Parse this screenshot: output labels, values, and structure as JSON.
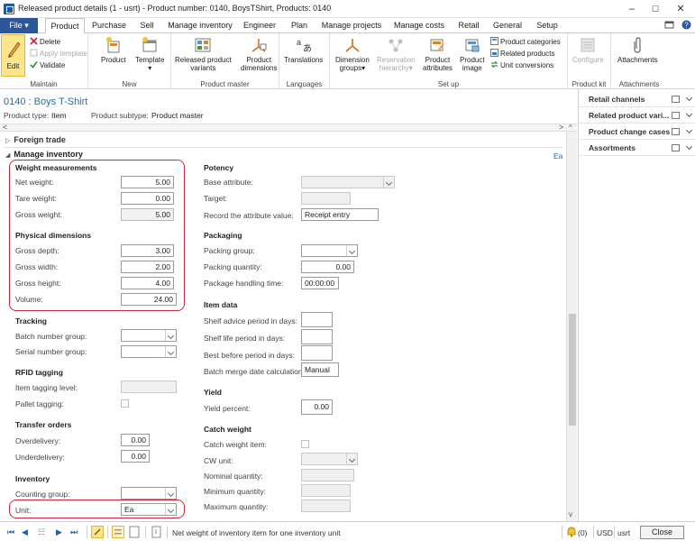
{
  "window": {
    "title": "Released product details (1 - usrt) - Product number: 0140, BoysTShirt, Products: 0140",
    "controls": {
      "minimize": "–",
      "maximize": "☐",
      "close": "✕"
    }
  },
  "ribbon_tabs": {
    "file": "File",
    "file_caret": "▾",
    "items": [
      "Product",
      "Purchase",
      "Sell",
      "Manage inventory",
      "Engineer",
      "Plan",
      "Manage projects",
      "Manage costs",
      "Retail",
      "General",
      "Setup"
    ],
    "active_index": 0
  },
  "ribbon": {
    "maintain": {
      "label": "Maintain",
      "edit": "Edit",
      "delete": "Delete",
      "apply_template": "Apply template",
      "validate": "Validate"
    },
    "new": {
      "label": "New",
      "product": "Product",
      "template": "Template"
    },
    "product_master": {
      "label": "Product master",
      "released_product_variants_1": "Released product",
      "released_product_variants_2": "variants",
      "product_dimensions_1": "Product",
      "product_dimensions_2": "dimensions"
    },
    "languages": {
      "label": "Languages",
      "translations": "Translations"
    },
    "setup": {
      "label": "Set up",
      "dimension_groups_1": "Dimension",
      "dimension_groups_2": "groups▾",
      "reservation_hierarchy_1": "Reservation",
      "reservation_hierarchy_2": "hierarchy▾",
      "product_attributes_1": "Product",
      "product_attributes_2": "attributes",
      "product_image_1": "Product",
      "product_image_2": "image",
      "product_categories": "Product categories",
      "related_products": "Related products",
      "unit_conversions": "Unit conversions"
    },
    "product_kit": {
      "label": "Product kit",
      "configure": "Configure"
    },
    "attachments": {
      "label": "Attachments",
      "attachments": "Attachments"
    }
  },
  "header": {
    "record_title": "0140 : Boys T-Shirt",
    "product_type_label": "Product type:",
    "product_type_value": "Item",
    "product_subtype_label": "Product subtype:",
    "product_subtype_value": "Product master"
  },
  "fasttabs": {
    "foreign_trade": "Foreign trade",
    "manage_inventory": "Manage inventory",
    "unit_hint": "Ea"
  },
  "weight_measurements": {
    "title": "Weight measurements",
    "net_weight_label": "Net weight:",
    "net_weight_value": "5.00",
    "tare_weight_label": "Tare weight:",
    "tare_weight_value": "0.00",
    "gross_weight_label": "Gross weight:",
    "gross_weight_value": "5.00"
  },
  "physical_dimensions": {
    "title": "Physical dimensions",
    "gross_depth_label": "Gross depth:",
    "gross_depth_value": "3.00",
    "gross_width_label": "Gross width:",
    "gross_width_value": "2.00",
    "gross_height_label": "Gross height:",
    "gross_height_value": "4.00",
    "volume_label": "Volume:",
    "volume_value": "24.00"
  },
  "tracking": {
    "title": "Tracking",
    "batch_number_group_label": "Batch number group:",
    "batch_number_group_value": "",
    "serial_number_group_label": "Serial number group:",
    "serial_number_group_value": ""
  },
  "rfid_tagging": {
    "title": "RFID tagging",
    "item_tagging_level_label": "Item tagging level:",
    "item_tagging_level_value": "",
    "pallet_tagging_label": "Pallet tagging:"
  },
  "transfer_orders": {
    "title": "Transfer orders",
    "overdelivery_label": "Overdelivery:",
    "overdelivery_value": "0.00",
    "underdelivery_label": "Underdelivery:",
    "underdelivery_value": "0.00"
  },
  "inventory": {
    "title": "Inventory",
    "counting_group_label": "Counting group:",
    "counting_group_value": "",
    "unit_label": "Unit:",
    "unit_value": "Ea"
  },
  "potency": {
    "title": "Potency",
    "base_attribute_label": "Base attribute:",
    "base_attribute_value": "",
    "target_label": "Target:",
    "target_value": "",
    "record_attribute_label": "Record the attribute value:",
    "record_attribute_value": "Receipt entry"
  },
  "packaging": {
    "title": "Packaging",
    "packing_group_label": "Packing group:",
    "packing_group_value": "",
    "packing_quantity_label": "Packing quantity:",
    "packing_quantity_value": "0.00",
    "package_handling_time_label": "Package handling time:",
    "package_handling_time_value": "00:00:00"
  },
  "item_data": {
    "title": "Item data",
    "shelf_advice_label": "Shelf advice period in days:",
    "shelf_advice_value": "",
    "shelf_life_label": "Shelf life period in days:",
    "shelf_life_value": "",
    "best_before_label": "Best before period in days:",
    "best_before_value": "",
    "batch_merge_label": "Batch merge date calculation:",
    "batch_merge_value": "Manual"
  },
  "yield": {
    "title": "Yield",
    "yield_percent_label": "Yield percent:",
    "yield_percent_value": "0.00"
  },
  "catch_weight": {
    "title": "Catch weight",
    "catch_weight_item_label": "Catch weight item:",
    "cw_unit_label": "CW unit:",
    "cw_unit_value": "",
    "nominal_quantity_label": "Nominal quantity:",
    "nominal_quantity_value": "",
    "minimum_quantity_label": "Minimum quantity:",
    "minimum_quantity_value": "",
    "maximum_quantity_label": "Maximum quantity:",
    "maximum_quantity_value": ""
  },
  "factbox": {
    "items": [
      "Retail channels",
      "Related product vari...",
      "Product change cases",
      "Assortments"
    ]
  },
  "statusbar": {
    "nav_first": "⏮",
    "nav_prev": "◀",
    "nav_grid": "☷",
    "nav_next": "▶",
    "nav_last": "⏭",
    "help_text": "Net weight of inventory item for one inventory unit",
    "notifications": "(0)",
    "currency": "USD",
    "company": "usrt",
    "close_label": "Close"
  },
  "colors": {
    "accent": "#2b579a",
    "title_blue": "#1f6fa3",
    "highlight_red": "#c8283c",
    "edit_yellow": "#fde58c"
  }
}
